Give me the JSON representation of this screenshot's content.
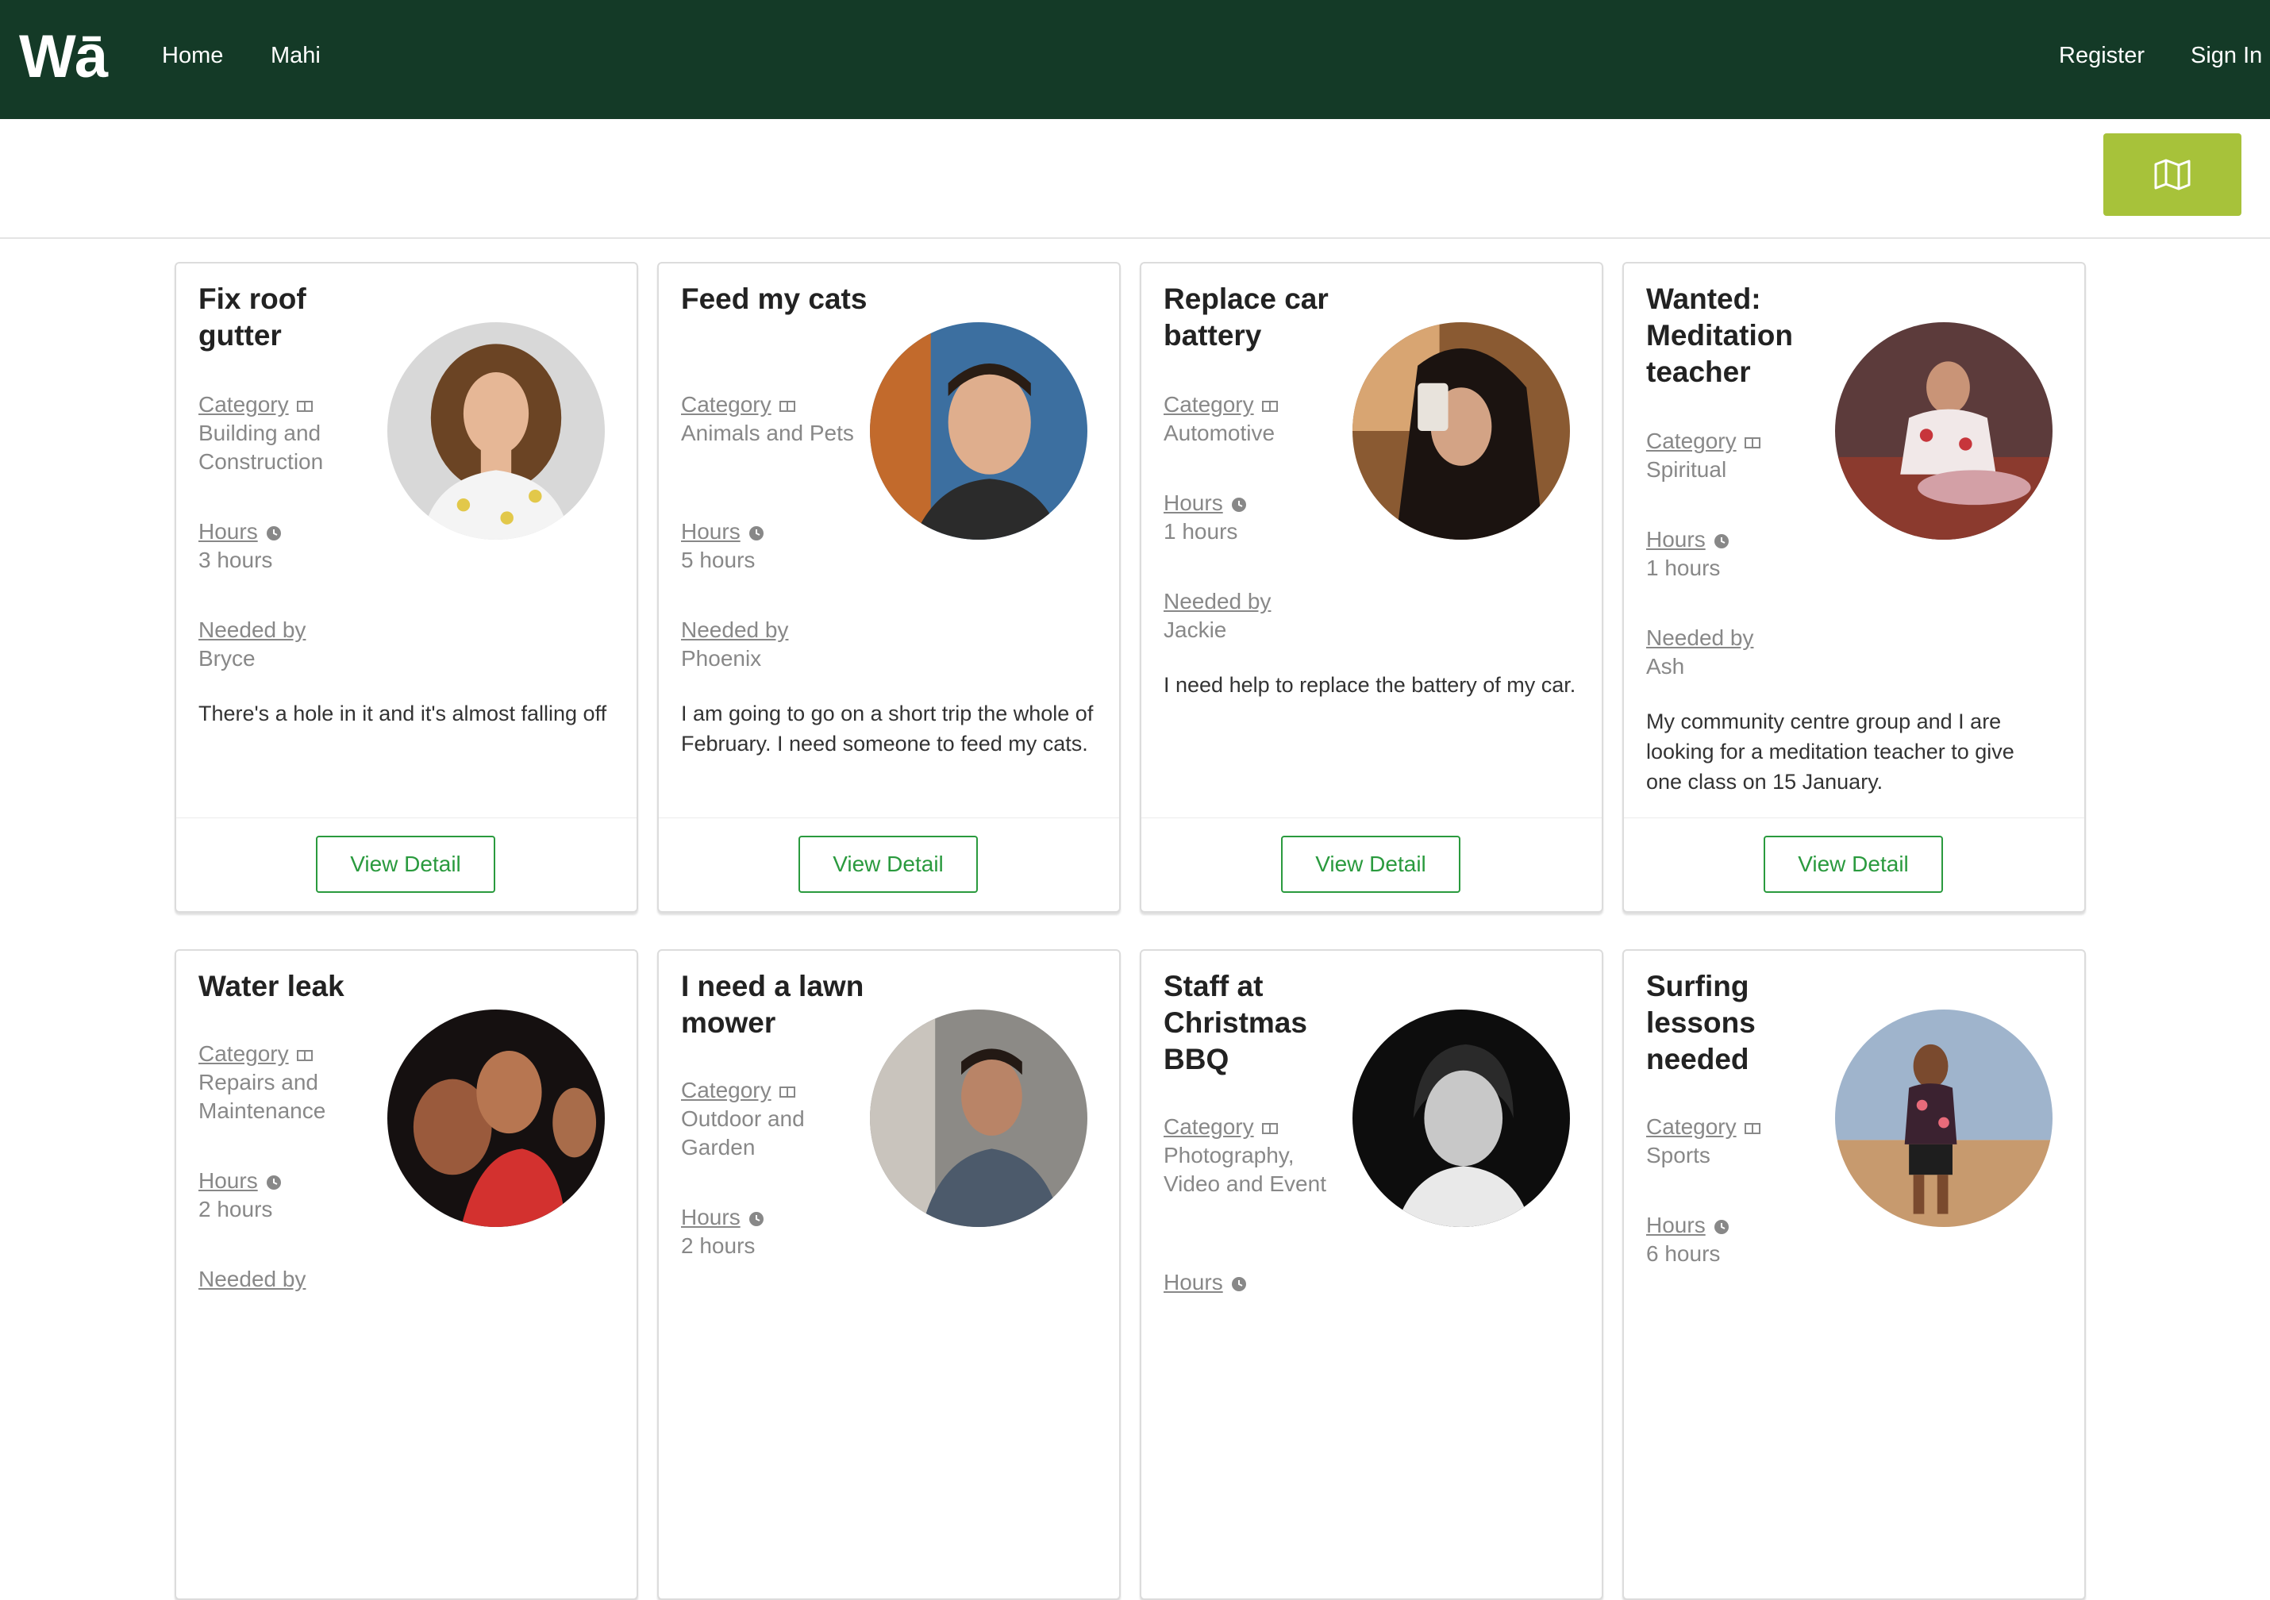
{
  "nav": {
    "logo": "Wā",
    "links": [
      "Home",
      "Mahi"
    ],
    "register": "Register",
    "sign_in": "Sign In"
  },
  "map_button": {
    "icon": "map-icon"
  },
  "labels": {
    "category": "Category",
    "hours": "Hours",
    "needed_by": "Needed by",
    "view_detail": "View Detail"
  },
  "colors": {
    "nav_bg": "#143a27",
    "map_button": "#a7c23a",
    "view_button": "#2a9a3e"
  },
  "cards": [
    {
      "title": "Fix roof gutter",
      "category": "Building and Construction",
      "hours": "3 hours",
      "needed_by": "Bryce",
      "description": "There's a hole in it and it's almost falling off"
    },
    {
      "title": "Feed my cats",
      "category": "Animals and Pets",
      "hours": "5 hours",
      "needed_by": "Phoenix",
      "description": "I am going to go on a short trip the whole of February. I need someone to feed my cats."
    },
    {
      "title": "Replace car battery",
      "category": "Automotive",
      "hours": "1 hours",
      "needed_by": "Jackie",
      "description": "I need help to replace the battery of my car."
    },
    {
      "title": "Wanted: Meditation teacher",
      "category": "Spiritual",
      "hours": "1 hours",
      "needed_by": "Ash",
      "description": "My community centre group and I are looking for a meditation teacher to give one class on 15 January."
    },
    {
      "title": "Water leak",
      "category": "Repairs and Maintenance",
      "hours": "2 hours",
      "needed_by": "",
      "description": ""
    },
    {
      "title": "I need a lawn mower",
      "category": "Outdoor and Garden",
      "hours": "2 hours",
      "needed_by": "",
      "description": ""
    },
    {
      "title": "Staff at Christmas BBQ",
      "category": "Photography, Video and Event",
      "hours": "",
      "needed_by": "",
      "description": ""
    },
    {
      "title": "Surfing lessons needed",
      "category": "Sports",
      "hours": "6 hours",
      "needed_by": "",
      "description": ""
    }
  ]
}
